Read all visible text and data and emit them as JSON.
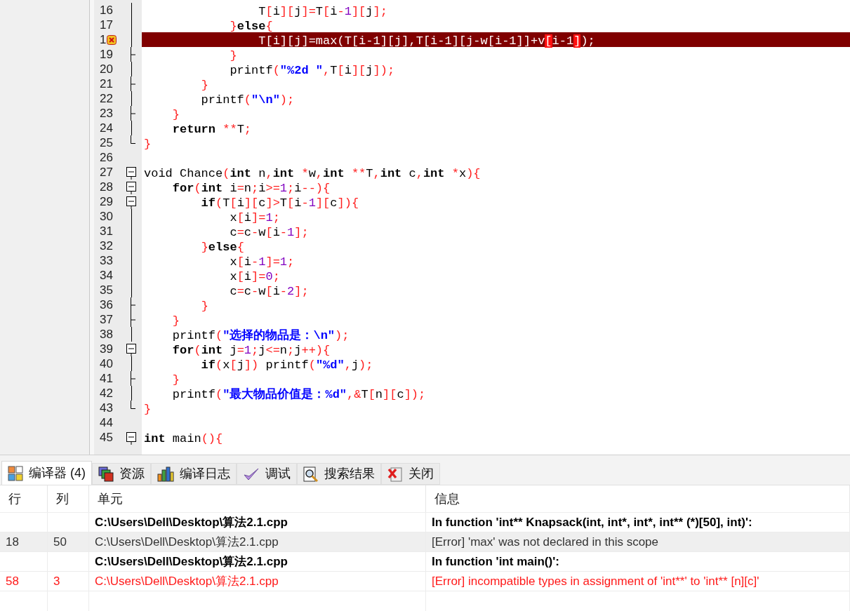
{
  "editor": {
    "lines": [
      {
        "number": "16",
        "kind": "fold_line",
        "error": false,
        "segments": [
          {
            "kind": "code",
            "text": "                T[i][j]=T[i-1][j];"
          }
        ]
      },
      {
        "number": "17",
        "kind": "fold_line",
        "error": false,
        "segments": [
          {
            "kind": "code",
            "text": "            }"
          },
          {
            "kind": "keyword",
            "text": "else"
          },
          {
            "kind": "code",
            "text": "{"
          }
        ]
      },
      {
        "number": "1",
        "kind": "fold_line",
        "error": true,
        "segments": [
          {
            "kind": "code",
            "text": "                T[i][j]=max(T[i-1][j],T[i-1][j-w[i-1]]+v"
          },
          {
            "kind": "match",
            "text": "["
          },
          {
            "kind": "code",
            "text": "i-1"
          },
          {
            "kind": "match",
            "text": "]"
          },
          {
            "kind": "code",
            "text": ");"
          }
        ]
      },
      {
        "number": "19",
        "kind": "fold_end",
        "error": false,
        "segments": [
          {
            "kind": "code",
            "text": "            }"
          }
        ]
      },
      {
        "number": "20",
        "kind": "fold_line",
        "error": false,
        "segments": [
          {
            "kind": "code",
            "text": "            printf("
          },
          {
            "kind": "string",
            "text": "\"%2d \""
          },
          {
            "kind": "code",
            "text": ",T[i][j]);"
          }
        ]
      },
      {
        "number": "21",
        "kind": "fold_end",
        "error": false,
        "segments": [
          {
            "kind": "code",
            "text": "        }"
          }
        ]
      },
      {
        "number": "22",
        "kind": "fold_line",
        "error": false,
        "segments": [
          {
            "kind": "code",
            "text": "        printf("
          },
          {
            "kind": "string",
            "text": "\"\\n\""
          },
          {
            "kind": "code",
            "text": ");"
          }
        ]
      },
      {
        "number": "23",
        "kind": "fold_end",
        "error": false,
        "segments": [
          {
            "kind": "code",
            "text": "    }"
          }
        ]
      },
      {
        "number": "24",
        "kind": "fold_line",
        "error": false,
        "segments": [
          {
            "kind": "keyword",
            "text": "    return"
          },
          {
            "kind": "code",
            "text": " **T;"
          }
        ]
      },
      {
        "number": "25",
        "kind": "fold_last",
        "error": false,
        "segments": [
          {
            "kind": "code",
            "text": "}"
          }
        ]
      },
      {
        "number": "26",
        "kind": "plain",
        "error": false
      },
      {
        "number": "27",
        "kind": "fold_start",
        "error": false,
        "segments": [
          {
            "kind": "code",
            "text": "void Chance("
          },
          {
            "kind": "keyword",
            "text": "int"
          },
          {
            "kind": "code",
            "text": " n,"
          },
          {
            "kind": "keyword",
            "text": "int"
          },
          {
            "kind": "code",
            "text": " *w,"
          },
          {
            "kind": "keyword",
            "text": "int"
          },
          {
            "kind": "code",
            "text": " **T,"
          },
          {
            "kind": "keyword",
            "text": "int"
          },
          {
            "kind": "code",
            "text": " c,"
          },
          {
            "kind": "keyword",
            "text": "int"
          },
          {
            "kind": "code",
            "text": " *x){"
          }
        ]
      },
      {
        "number": "28",
        "kind": "fold_start",
        "error": false,
        "segments": [
          {
            "kind": "keyword",
            "text": "    for"
          },
          {
            "kind": "code",
            "text": "("
          },
          {
            "kind": "keyword",
            "text": "int"
          },
          {
            "kind": "code",
            "text": " i=n;i>=1;i--){"
          }
        ]
      },
      {
        "number": "29",
        "kind": "fold_start",
        "error": false,
        "segments": [
          {
            "kind": "keyword",
            "text": "        if"
          },
          {
            "kind": "code",
            "text": "(T[i][c]>T[i-1][c]){"
          }
        ]
      },
      {
        "number": "30",
        "kind": "fold_line",
        "error": false,
        "segments": [
          {
            "kind": "code",
            "text": "            x[i]=1;"
          }
        ]
      },
      {
        "number": "31",
        "kind": "fold_line",
        "error": false,
        "segments": [
          {
            "kind": "code",
            "text": "            c=c-w[i-1];"
          }
        ]
      },
      {
        "number": "32",
        "kind": "fold_line",
        "error": false,
        "segments": [
          {
            "kind": "code",
            "text": "        }"
          },
          {
            "kind": "keyword",
            "text": "else"
          },
          {
            "kind": "code",
            "text": "{"
          }
        ]
      },
      {
        "number": "33",
        "kind": "fold_line",
        "error": false,
        "segments": [
          {
            "kind": "code",
            "text": "            x[i-1]=1;"
          }
        ]
      },
      {
        "number": "34",
        "kind": "fold_line",
        "error": false,
        "segments": [
          {
            "kind": "code",
            "text": "            x[i]=0;"
          }
        ]
      },
      {
        "number": "35",
        "kind": "fold_line",
        "error": false,
        "segments": [
          {
            "kind": "code",
            "text": "            c=c-w[i-2];"
          }
        ]
      },
      {
        "number": "36",
        "kind": "fold_end",
        "error": false,
        "segments": [
          {
            "kind": "code",
            "text": "        }"
          }
        ]
      },
      {
        "number": "37",
        "kind": "fold_end",
        "error": false,
        "segments": [
          {
            "kind": "code",
            "text": "    }"
          }
        ]
      },
      {
        "number": "38",
        "kind": "fold_line",
        "error": false,
        "segments": [
          {
            "kind": "code",
            "text": "    printf("
          },
          {
            "kind": "string",
            "text": "\"选择的物品是：\\n\""
          },
          {
            "kind": "code",
            "text": ");"
          }
        ]
      },
      {
        "number": "39",
        "kind": "fold_start",
        "error": false,
        "segments": [
          {
            "kind": "keyword",
            "text": "    for"
          },
          {
            "kind": "code",
            "text": "("
          },
          {
            "kind": "keyword",
            "text": "int"
          },
          {
            "kind": "code",
            "text": " j=1;j<=n;j++){"
          }
        ]
      },
      {
        "number": "40",
        "kind": "fold_line",
        "error": false,
        "segments": [
          {
            "kind": "keyword",
            "text": "        if"
          },
          {
            "kind": "code",
            "text": "(x[j]) printf("
          },
          {
            "kind": "string",
            "text": "\"%d\""
          },
          {
            "kind": "code",
            "text": ",j);"
          }
        ]
      },
      {
        "number": "41",
        "kind": "fold_end",
        "error": false,
        "segments": [
          {
            "kind": "code",
            "text": "    }"
          }
        ]
      },
      {
        "number": "42",
        "kind": "fold_line",
        "error": false,
        "segments": [
          {
            "kind": "code",
            "text": "    printf("
          },
          {
            "kind": "string",
            "text": "\"最大物品价值是：%d\""
          },
          {
            "kind": "code",
            "text": ",&T[n][c]);"
          }
        ]
      },
      {
        "number": "43",
        "kind": "fold_last",
        "error": false,
        "segments": [
          {
            "kind": "code",
            "text": "}"
          }
        ]
      },
      {
        "number": "44",
        "kind": "plain",
        "error": false
      },
      {
        "number": "45",
        "kind": "fold_start",
        "error": false,
        "segments": [
          {
            "kind": "keyword",
            "text": "int"
          },
          {
            "kind": "code",
            "text": " main(){"
          }
        ]
      }
    ]
  },
  "tabs": [
    {
      "label": "编译器 (4)",
      "selected": true
    },
    {
      "label": "资源",
      "selected": false
    },
    {
      "label": "编译日志",
      "selected": false
    },
    {
      "label": "调试",
      "selected": false
    },
    {
      "label": "搜索结果",
      "selected": false
    },
    {
      "label": "关闭",
      "selected": false
    }
  ],
  "table": {
    "columns": [
      "行",
      "列",
      "单元",
      "信息"
    ],
    "rows": [
      {
        "kind": "context",
        "selected": false,
        "color": "#000000",
        "cells": [
          "",
          "",
          "C:\\Users\\Dell\\Desktop\\算法2.1.cpp",
          "In function 'int** Knapsack(int, int*, int*, int** (*)[50], int)':"
        ]
      },
      {
        "kind": "message",
        "selected": true,
        "color": "#333333",
        "cells": [
          "18",
          "50",
          "C:\\Users\\Dell\\Desktop\\算法2.1.cpp",
          "[Error] 'max' was not declared in this scope"
        ]
      },
      {
        "kind": "context",
        "selected": false,
        "color": "#000000",
        "cells": [
          "",
          "",
          "C:\\Users\\Dell\\Desktop\\算法2.1.cpp",
          "In function 'int main()':"
        ]
      },
      {
        "kind": "message",
        "selected": false,
        "color": "#ff1a1a",
        "cells": [
          "58",
          "3",
          "C:\\Users\\Dell\\Desktop\\算法2.1.cpp",
          "[Error] incompatible types in assignment of 'int**' to 'int** [n][c]'"
        ]
      }
    ]
  }
}
